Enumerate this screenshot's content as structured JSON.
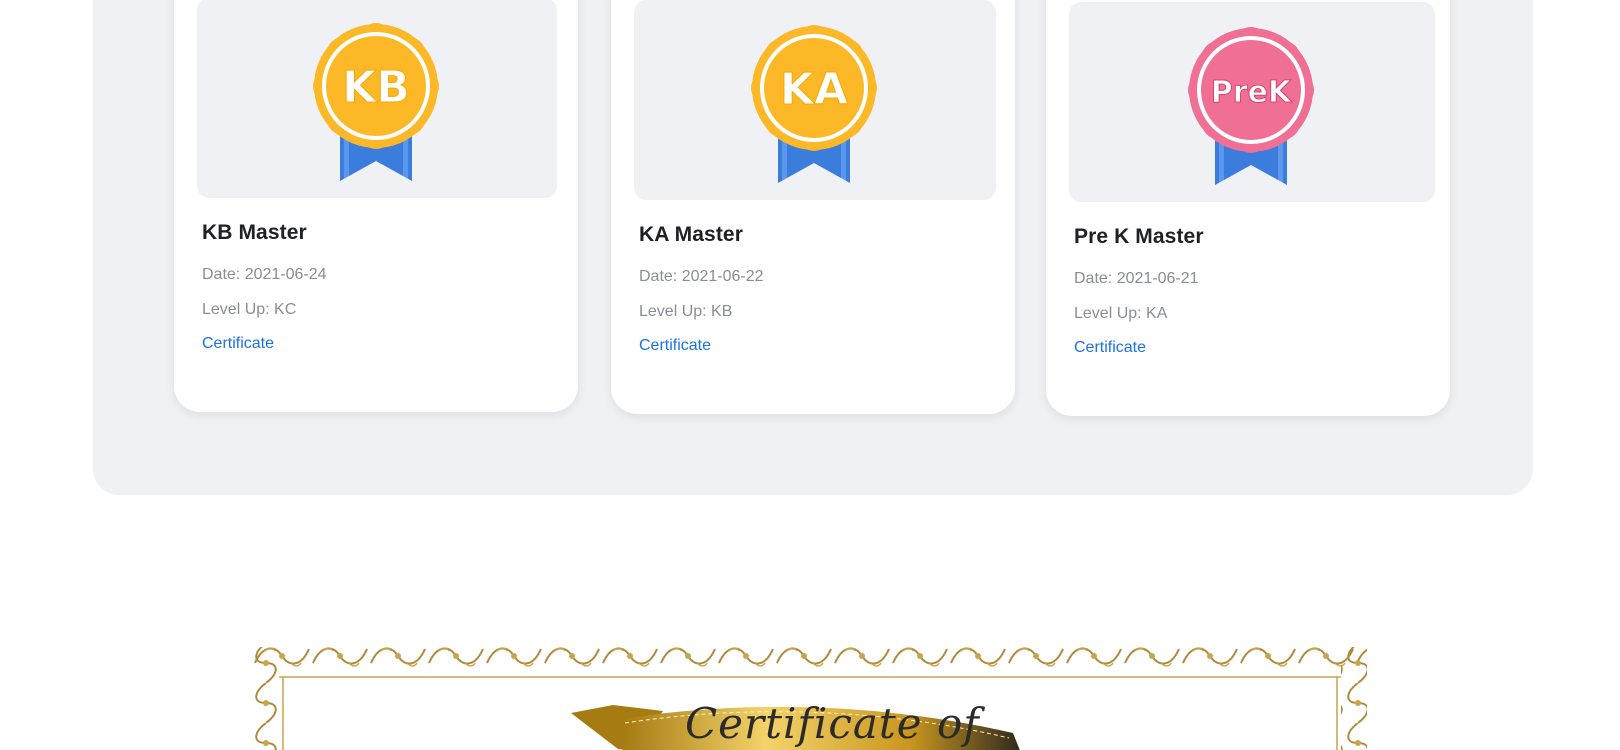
{
  "achievements": [
    {
      "badge_text": "KB",
      "badge_color": "#fdb827",
      "title": "KB Master",
      "date": "Date: 2021-06-24",
      "level_up": "Level Up: KC",
      "link_label": "Certificate"
    },
    {
      "badge_text": "KA",
      "badge_color": "#fdb827",
      "title": "KA Master",
      "date": "Date: 2021-06-22",
      "level_up": "Level Up: KB",
      "link_label": "Certificate"
    },
    {
      "badge_text": "PreK",
      "badge_color": "#f07095",
      "title": "Pre K Master",
      "date": "Date: 2021-06-21",
      "level_up": "Level Up: KA",
      "link_label": "Certificate"
    }
  ],
  "certificate": {
    "heading": "Certificate of",
    "border_color": "#b08a3a",
    "ribbon_color": "#d4a51c"
  },
  "colors": {
    "panel_bg": "#f0f1f5",
    "link": "#1a73e8",
    "ribbon_blue": "#3b7ddd"
  }
}
